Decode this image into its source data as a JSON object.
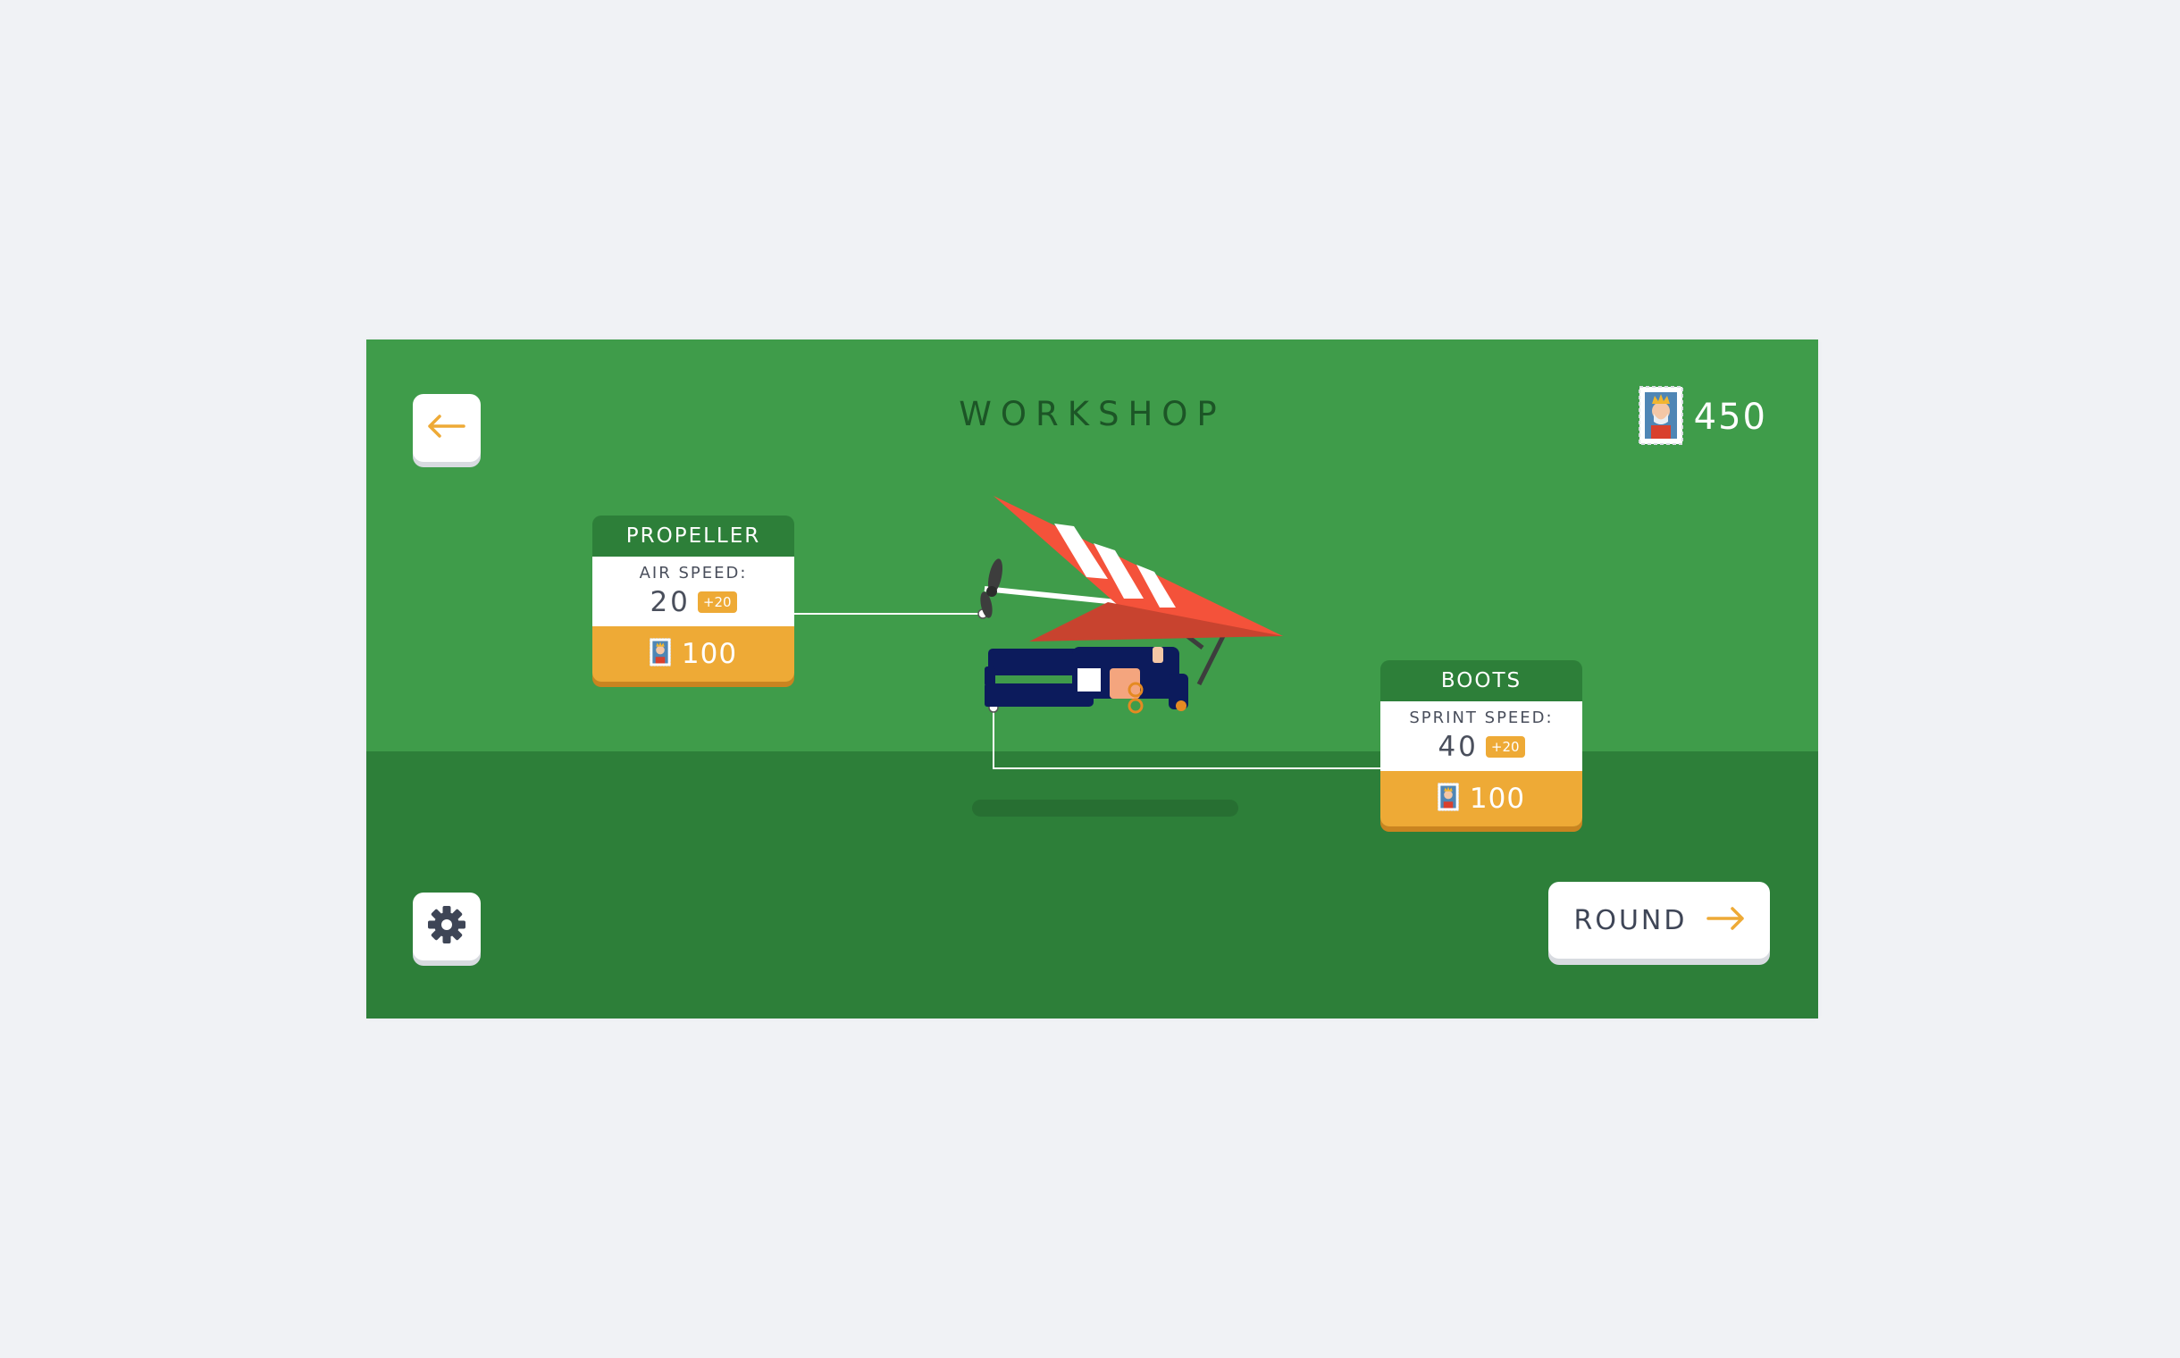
{
  "screen": {
    "title": "WORKSHOP"
  },
  "currency": {
    "icon": "stamp-icon",
    "amount": "450"
  },
  "buttons": {
    "back_icon": "arrow-left-icon",
    "settings_icon": "gear-icon",
    "round_label": "ROUND",
    "round_icon": "arrow-right-icon"
  },
  "upgrades": [
    {
      "name": "PROPELLER",
      "stat_label": "AIR SPEED:",
      "stat_value": "20",
      "bonus": "+20",
      "price_icon": "stamp-icon",
      "price": "100"
    },
    {
      "name": "BOOTS",
      "stat_label": "SPRINT SPEED:",
      "stat_value": "40",
      "bonus": "+20",
      "price_icon": "stamp-icon",
      "price": "100"
    }
  ],
  "colors": {
    "page_background": "#f0f2f5",
    "sky": "#3f9c4a",
    "ground": "#2d7f39",
    "accent_orange": "#eeaa36",
    "card_header": "#2d7f39",
    "glider_red": "#f4523a",
    "pilot_navy": "#0c1b5c"
  }
}
